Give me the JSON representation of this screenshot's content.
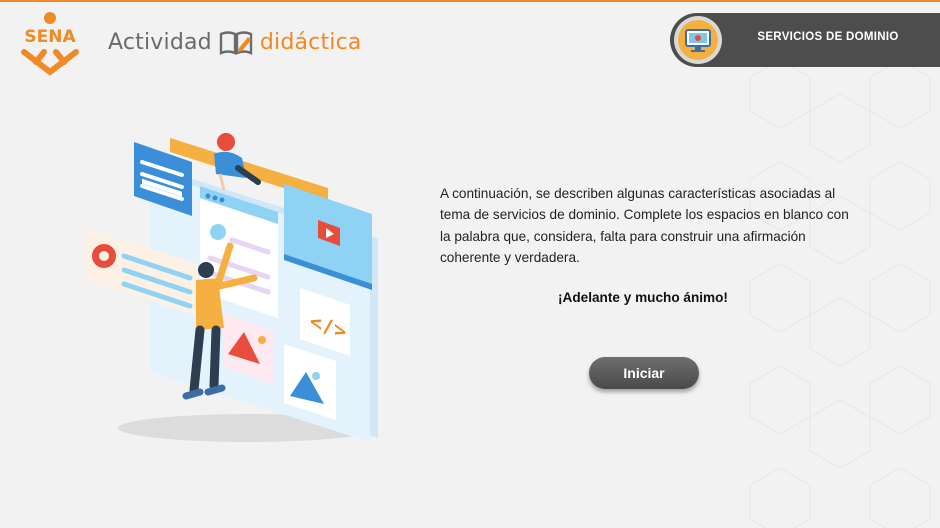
{
  "header": {
    "logo_text": "SENA",
    "brand_word1": "Actividad",
    "brand_word2": "didáctica",
    "module_title": "SERVICIOS DE DOMINIO"
  },
  "main": {
    "intro": "A continuación, se describen algunas características asociadas al tema de servicios de dominio. Complete los espacios en blanco con la palabra que, considera, falta para construir una afirmación coherente y verdadera.",
    "encouragement": "¡Adelante y mucho ánimo!",
    "start_button_label": "Iniciar"
  },
  "icons": {
    "logo": "sena-logo",
    "brand": "book-pencil-icon",
    "module": "computer-monitor-icon",
    "illustration": "web-design-illustration"
  },
  "colors": {
    "accent": "#f08a24",
    "dark_pill": "#4d4d4d",
    "button": "#5a5a5a"
  }
}
